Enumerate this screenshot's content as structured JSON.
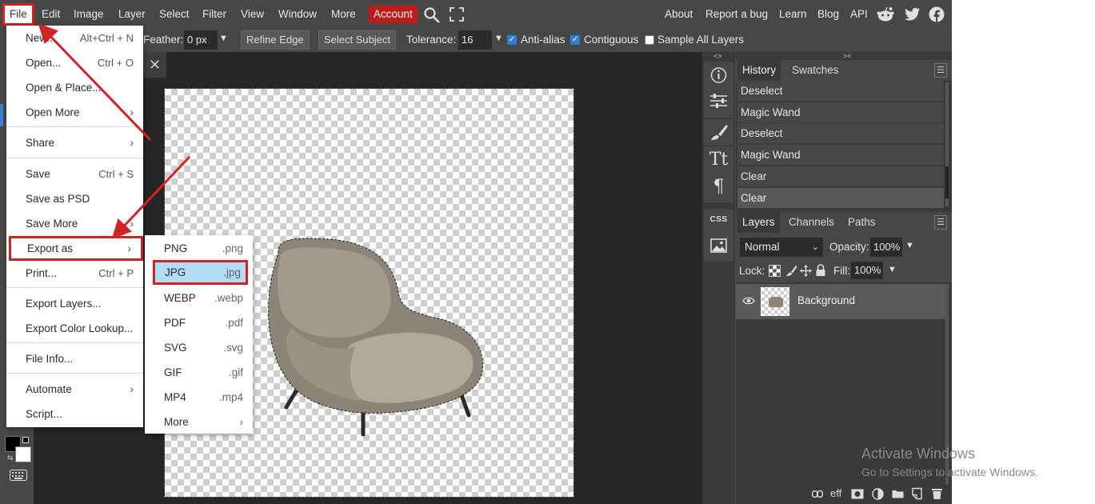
{
  "menubar": {
    "items": [
      "File",
      "Edit",
      "Image",
      "Layer",
      "Select",
      "Filter",
      "View",
      "Window",
      "More",
      "Account"
    ],
    "right_links": [
      "About",
      "Report a bug",
      "Learn",
      "Blog",
      "API"
    ],
    "icons": [
      "search-icon",
      "fullscreen-icon",
      "reddit-icon",
      "twitter-icon",
      "facebook-icon"
    ]
  },
  "options": {
    "feather_label": "Feather:",
    "feather_value": "0 px",
    "refine_edge": "Refine Edge",
    "select_subject": "Select Subject",
    "tolerance_label": "Tolerance:",
    "tolerance_value": "16",
    "anti_alias": "Anti-alias",
    "contiguous": "Contiguous",
    "sample_all_layers": "Sample All Layers"
  },
  "file_menu": {
    "new": "New...",
    "new_sc": "Alt+Ctrl + N",
    "open": "Open...",
    "open_sc": "Ctrl + O",
    "open_place": "Open & Place...",
    "open_more": "Open More",
    "share": "Share",
    "save": "Save",
    "save_sc": "Ctrl + S",
    "save_psd": "Save as PSD",
    "save_more": "Save More",
    "export_as": "Export as",
    "print": "Print...",
    "print_sc": "Ctrl + P",
    "export_layers": "Export Layers...",
    "export_color_lookup": "Export Color Lookup...",
    "file_info": "File Info...",
    "automate": "Automate",
    "script": "Script..."
  },
  "export_menu": [
    {
      "label": "PNG",
      "ext": ".png"
    },
    {
      "label": "JPG",
      "ext": ".jpg"
    },
    {
      "label": "WEBP",
      "ext": ".webp"
    },
    {
      "label": "PDF",
      "ext": ".pdf"
    },
    {
      "label": "SVG",
      "ext": ".svg"
    },
    {
      "label": "GIF",
      "ext": ".gif"
    },
    {
      "label": "MP4",
      "ext": ".mp4"
    },
    {
      "label": "More",
      "ext": ""
    }
  ],
  "history": {
    "tabs": [
      "History",
      "Swatches"
    ],
    "items": [
      "Deselect",
      "Magic Wand",
      "Deselect",
      "Magic Wand",
      "Clear",
      "Clear"
    ]
  },
  "layers": {
    "tabs": [
      "Layers",
      "Channels",
      "Paths"
    ],
    "blend_mode": "Normal",
    "opacity_label": "Opacity:",
    "opacity_value": "100%",
    "lock_label": "Lock:",
    "fill_label": "Fill:",
    "fill_value": "100%",
    "layer_name": "Background",
    "footer_text": "eff"
  },
  "tools_col": {
    "css_label": "CSS"
  },
  "watermark": {
    "title": "Activate Windows",
    "subtitle": "Go to Settings to activate Windows."
  },
  "colors": {
    "accent_red": "#d42121",
    "account_red": "#c11a1a",
    "panel_bg": "#474747",
    "highlight_blue": "#b3dcf7"
  }
}
